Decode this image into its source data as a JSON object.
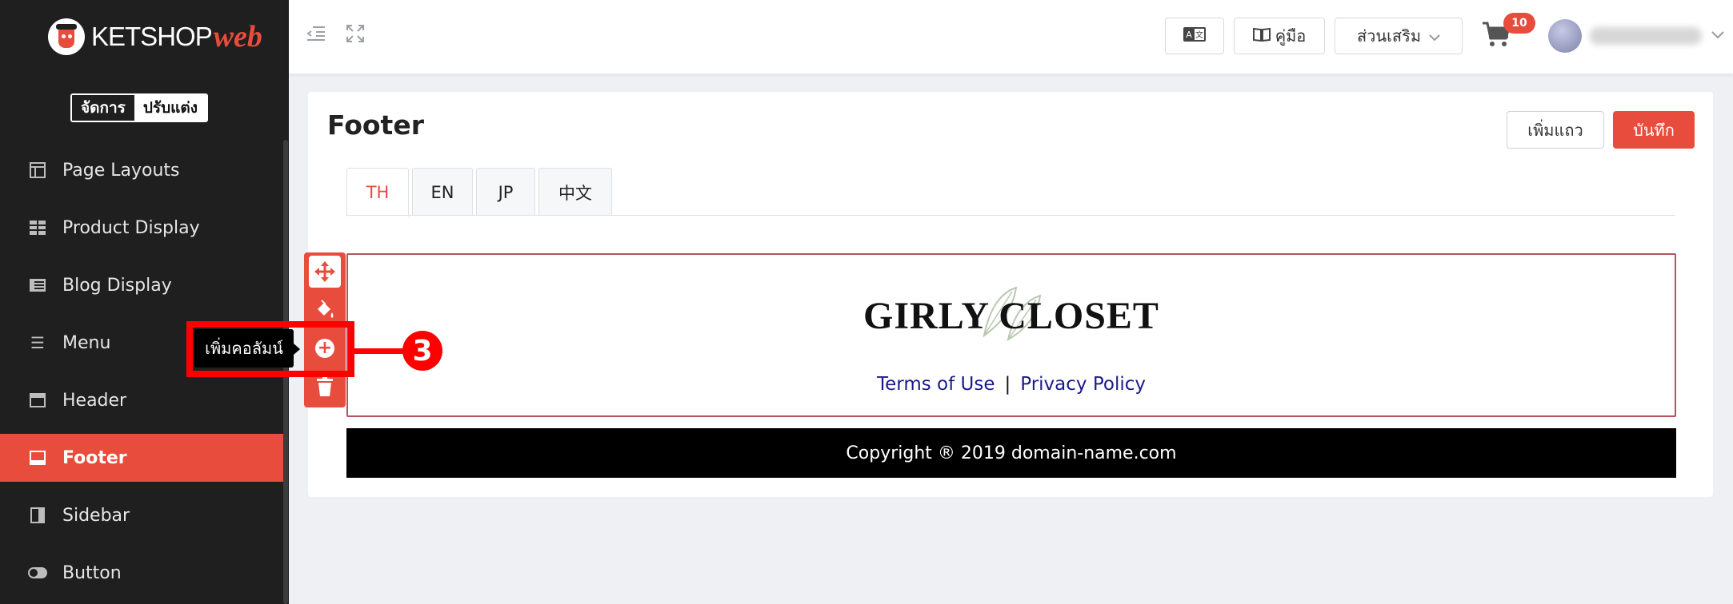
{
  "brand": {
    "name": "KETSHOP",
    "suffix": "web"
  },
  "mode_toggle": {
    "manage": "จัดการ",
    "customize": "ปรับแต่ง"
  },
  "sidebar": {
    "items": [
      {
        "label": "Page Layouts",
        "icon": "layout-icon"
      },
      {
        "label": "Product Display",
        "icon": "grid-icon"
      },
      {
        "label": "Blog Display",
        "icon": "list-icon"
      },
      {
        "label": "Menu",
        "icon": "menu-icon"
      },
      {
        "label": "Header",
        "icon": "header-icon"
      },
      {
        "label": "Footer",
        "icon": "footer-icon",
        "active": true
      },
      {
        "label": "Sidebar",
        "icon": "sidebar-icon"
      },
      {
        "label": "Button",
        "icon": "toggle-icon"
      }
    ]
  },
  "topbar": {
    "manual_label": "คู่มือ",
    "addons_label": "ส่วนเสริม",
    "cart_count": "10"
  },
  "page": {
    "title": "Footer",
    "add_row_label": "เพิ่มแถว",
    "save_label": "บันทึก",
    "tabs": [
      "TH",
      "EN",
      "JP",
      "中文"
    ],
    "active_tab": "TH"
  },
  "footer_preview": {
    "brand_text": "GIRLY CLOSET",
    "link_terms": "Terms of Use",
    "link_separator": "|",
    "link_privacy": "Privacy Policy",
    "copyright": "Copyright ® 2019 domain-name.com"
  },
  "row_tools": {
    "tooltip": "เพิ่มคอลัมน์",
    "callout_number": "3"
  },
  "colors": {
    "accent": "#e84c3d",
    "sidebar_bg": "#1f1f1f",
    "highlight": "#ff0000"
  }
}
